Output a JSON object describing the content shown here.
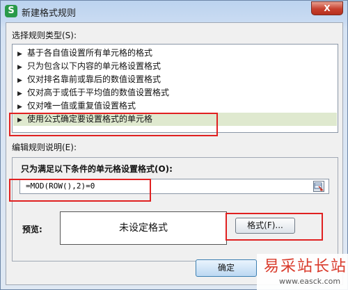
{
  "window": {
    "app_icon_letter": "S",
    "title": "新建格式规则",
    "close_label": "X"
  },
  "rule_type": {
    "label": "选择规则类型(S):",
    "items": [
      {
        "label": "基于各自值设置所有单元格的格式",
        "selected": false
      },
      {
        "label": "只为包含以下内容的单元格设置格式",
        "selected": false
      },
      {
        "label": "仅对排名靠前或靠后的数值设置格式",
        "selected": false
      },
      {
        "label": "仅对高于或低于平均值的数值设置格式",
        "selected": false
      },
      {
        "label": "仅对唯一值或重复值设置格式",
        "selected": false
      },
      {
        "label": "使用公式确定要设置格式的单元格",
        "selected": true
      }
    ]
  },
  "edit_desc": {
    "label": "编辑规则说明(E):",
    "condition_label": "只为满足以下条件的单元格设置格式(O):",
    "formula_value": "=MOD(ROW(),2)=0",
    "preview_label": "预览:",
    "preview_text": "未设定格式",
    "format_button": "格式(F)..."
  },
  "footer": {
    "ok_button": "确定"
  },
  "watermark": {
    "title": "易采站长站",
    "url": "www.easck.com"
  },
  "colors": {
    "highlight_red": "#e02020",
    "selected_row": "#dfe9cf",
    "title_bar": "#c9dbf2"
  },
  "icons": {
    "app": "wps-spreadsheet-icon",
    "close": "close-icon",
    "list_arrow": "triangle-right-icon",
    "range_select": "range-select-icon"
  }
}
